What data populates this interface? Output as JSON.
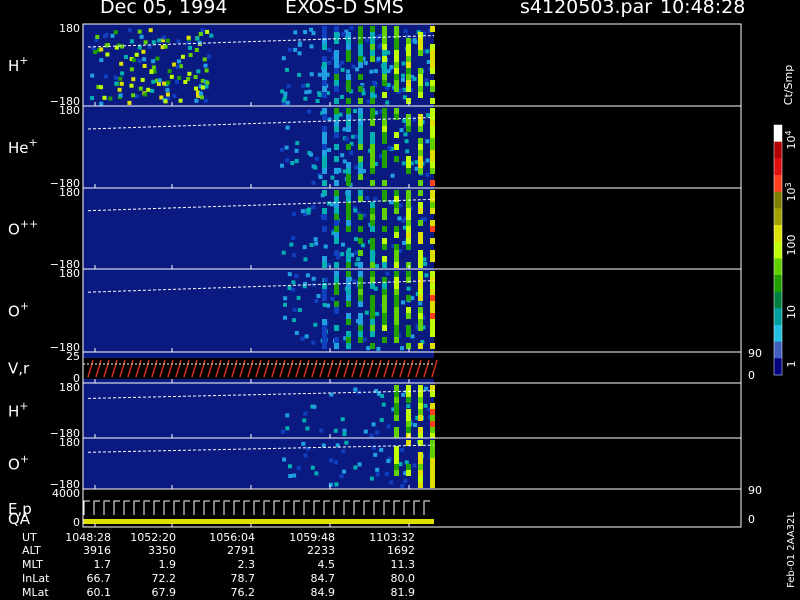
{
  "header": {
    "date": "Dec 05, 1994",
    "instrument": "EXOS-D SMS",
    "file": "s4120503.par",
    "time": "10:48:28"
  },
  "colorbar": {
    "units": "Ct/Smp",
    "tick_labels": [
      "10",
      "10",
      "100",
      "10",
      "1"
    ],
    "tick_exps": [
      "4",
      "3",
      "",
      "",
      ""
    ],
    "colors": [
      "#ffffff",
      "#b00000",
      "#e01010",
      "#ff4020",
      "#808000",
      "#a0a000",
      "#e0e000",
      "#c0ff00",
      "#60d000",
      "#20a000",
      "#008040",
      "#00a0a0",
      "#20c0e0",
      "#4060c0",
      "#000080"
    ]
  },
  "side_label": "Feb-01 2AA32L",
  "chart_data": {
    "type": "heatmap",
    "time_axis": {
      "labels": [
        "1048:28",
        "1052:20",
        "1056:04",
        "1059:48",
        "1103:32"
      ]
    },
    "panels": [
      {
        "label": "H",
        "sup": "+",
        "ytop": "180",
        "ybot": "−180"
      },
      {
        "label": "He",
        "sup": "+",
        "ytop": "180",
        "ybot": "−180"
      },
      {
        "label": "O",
        "sup": "++",
        "ytop": "180",
        "ybot": "−180"
      },
      {
        "label": "O",
        "sup": "+",
        "ytop": "180",
        "ybot": "−180"
      },
      {
        "label": "V,r",
        "sup": "",
        "ytop": "25",
        "ybot": "0",
        "right_top": "90",
        "right_bot": "0"
      },
      {
        "label": "H",
        "sup": "+",
        "ytop": "180",
        "ybot": "−180"
      },
      {
        "label": "O",
        "sup": "+",
        "ytop": "180",
        "ybot": "−180"
      },
      {
        "label": "E,p",
        "label2": "QA",
        "sup": "",
        "ytop": "4000",
        "ybot": "0",
        "right_top": "90",
        "right_bot": "0"
      }
    ],
    "orbit_table": [
      {
        "name": "UT",
        "values": [
          "1048:28",
          "1052:20",
          "1056:04",
          "1059:48",
          "1103:32"
        ]
      },
      {
        "name": "ALT",
        "values": [
          "3916",
          "3350",
          "2791",
          "2233",
          "1692"
        ]
      },
      {
        "name": "MLT",
        "values": [
          "1.7",
          "1.9",
          "2.3",
          "4.5",
          "11.3"
        ]
      },
      {
        "name": "InLat",
        "values": [
          "66.7",
          "72.2",
          "78.7",
          "84.7",
          "80.0"
        ]
      },
      {
        "name": "MLat",
        "values": [
          "60.1",
          "67.9",
          "76.2",
          "84.9",
          "81.9"
        ]
      }
    ]
  }
}
